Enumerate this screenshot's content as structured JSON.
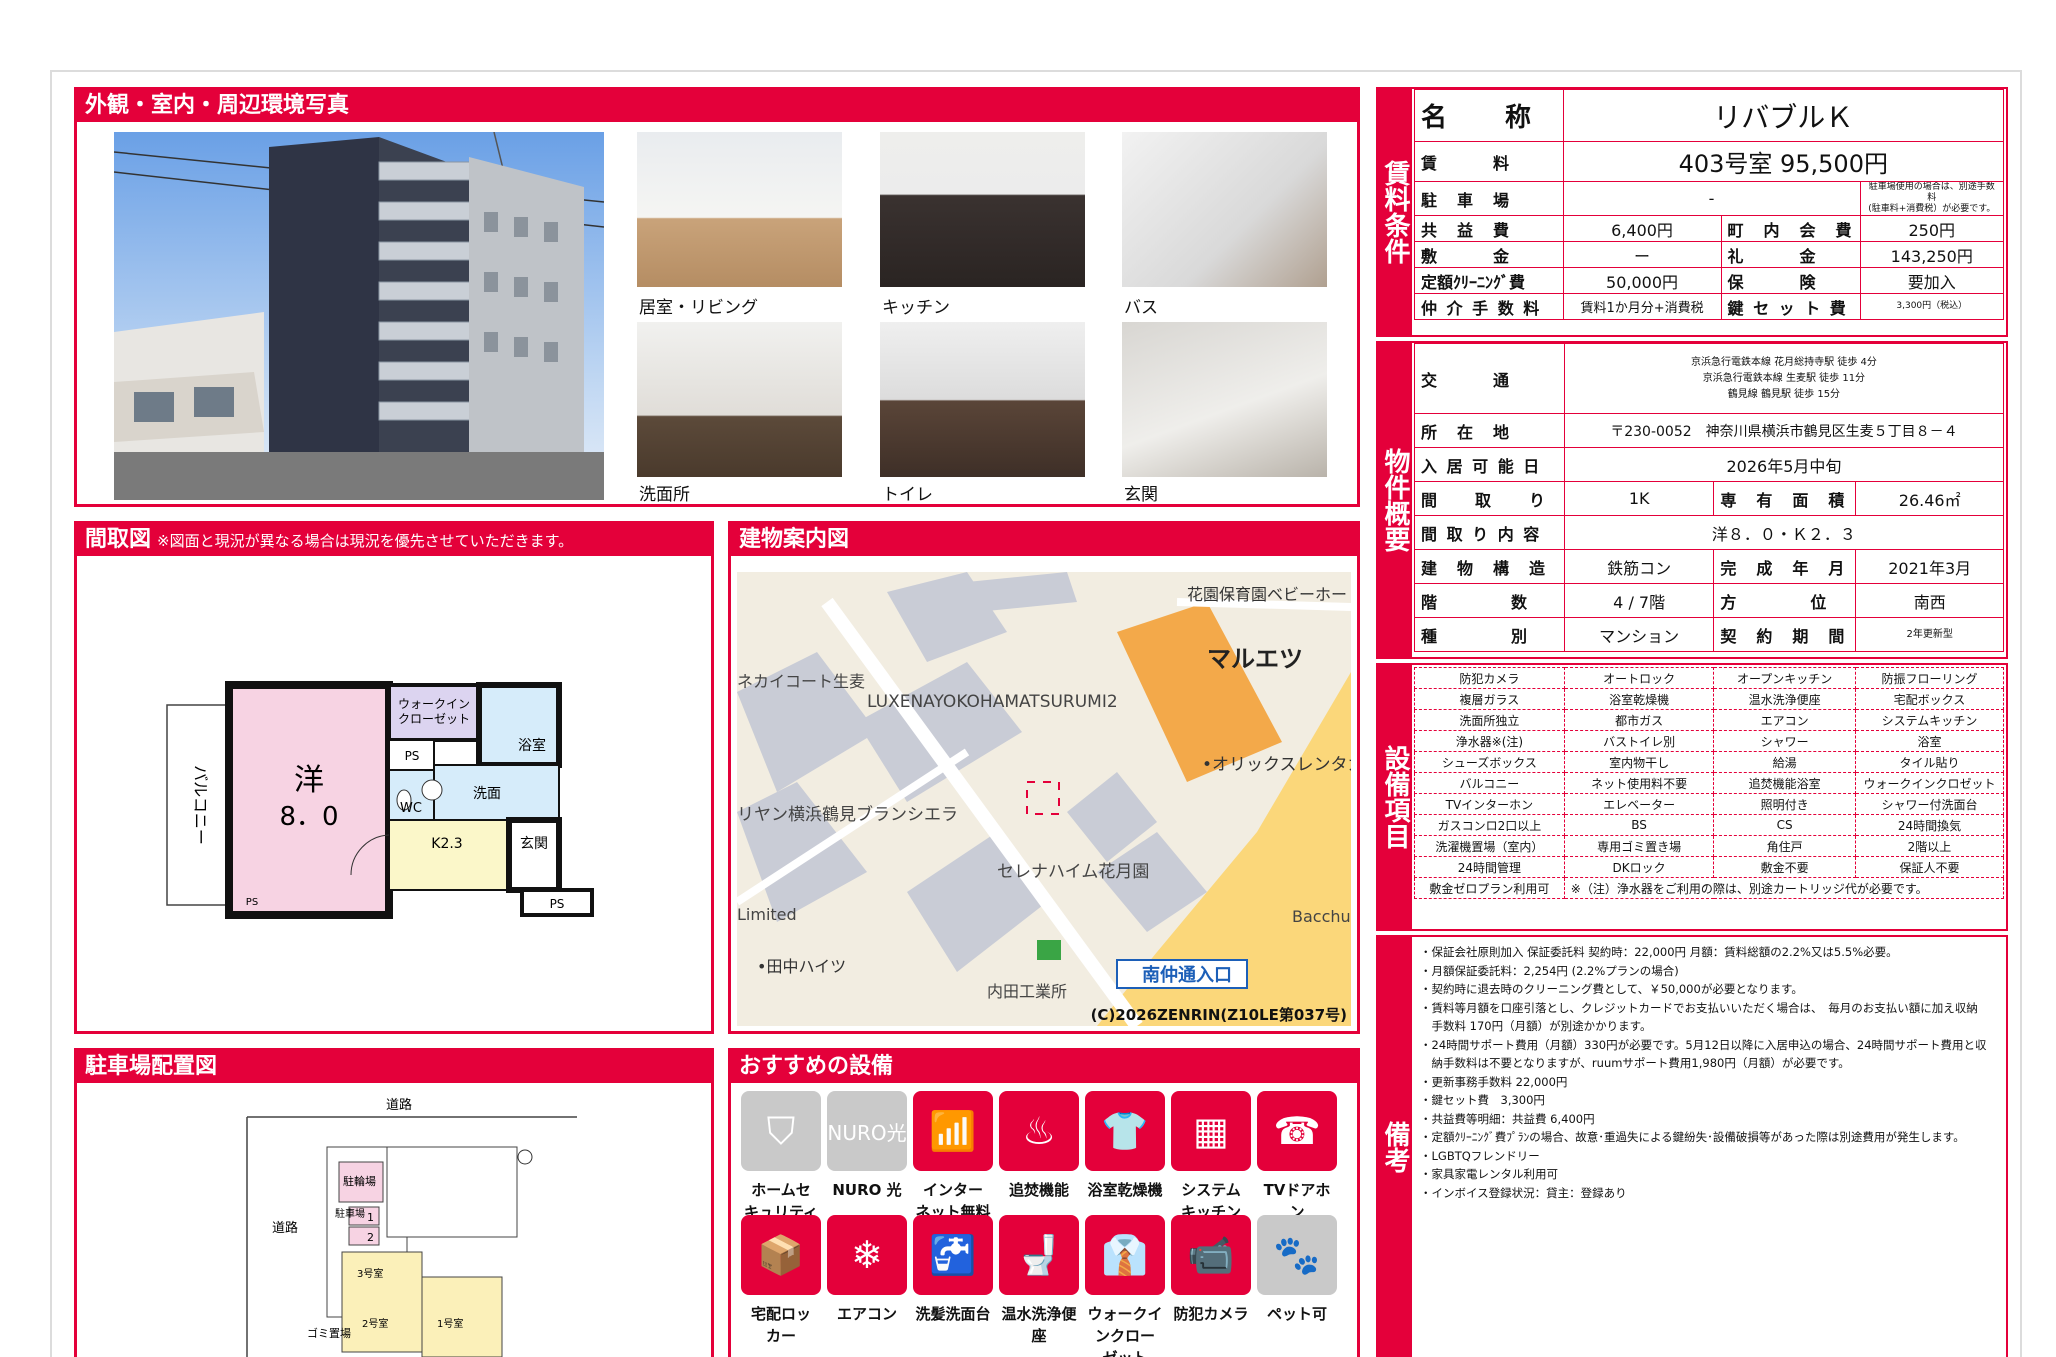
{
  "photos": {
    "title": "外観・室内・周辺環境写真",
    "items": [
      {
        "caption": "居室・リビング"
      },
      {
        "caption": "キッチン"
      },
      {
        "caption": "バス"
      },
      {
        "caption": "洗面所"
      },
      {
        "caption": "トイレ"
      },
      {
        "caption": "玄関"
      }
    ]
  },
  "floorplan": {
    "title": "間取図",
    "note": "※図面と現況が異なる場合は現況を優先させていただきます。",
    "labels": {
      "balcony": "バルコニー",
      "room": "洋",
      "room_size": "8．0",
      "closet": "ウォークイン\nクローゼット",
      "bath": "浴室",
      "ps": "PS",
      "wc": "WC",
      "washroom": "洗面",
      "kitchen": "K2.3",
      "entrance": "玄関",
      "ps2": "PS",
      "ps3": "PS"
    }
  },
  "mapinfo": {
    "title": "建物案内図",
    "labels": {
      "nursery": "花園保育園ベビーホー",
      "supermarket": "マルエツ",
      "cat": "ネカイコート生麦",
      "luxena": "LUXENAYOKOHAMATSURUMI2",
      "orix": "•オリックスレンタカ",
      "sereno": "リヤン横浜鶴見ブランシエラ",
      "serena": "セレナハイム花月園",
      "limited": "Limited",
      "tanaka": "•田中ハイツ",
      "uchida": "内田工業所",
      "minami": "南仲通入口",
      "bacchu": "Bacchu",
      "copyright": "(C)2026ZENRIN(Z10LE第037号)"
    }
  },
  "parking": {
    "title": "駐車場配置図",
    "labels": {
      "road_top": "道路",
      "road_left": "道路",
      "bike": "駐輪場",
      "car": "駐車場",
      "slot1": "1",
      "slot2": "2",
      "room3": "3号室",
      "room2": "2号室",
      "room1": "1号室",
      "garbage": "ゴミ置場"
    }
  },
  "recommended": {
    "title": "おすすめの設備",
    "items": [
      {
        "label": "ホームセ\nキュリティ",
        "icon": "shield-icon",
        "color": "#c9c9c9",
        "glyph": "⛉"
      },
      {
        "label": "NURO 光",
        "icon": "nuro-icon",
        "color": "#c9c9c9",
        "glyph": "NURO光"
      },
      {
        "label": "インター\nネット無料",
        "icon": "wifi-icon",
        "color": "#e4003a",
        "glyph": "📶"
      },
      {
        "label": "追焚機能",
        "icon": "bathtub-icon",
        "color": "#e4003a",
        "glyph": "♨"
      },
      {
        "label": "浴室乾燥機",
        "icon": "bath-dryer-icon",
        "color": "#e4003a",
        "glyph": "👕"
      },
      {
        "label": "システム\nキッチン",
        "icon": "kitchen-icon",
        "color": "#e4003a",
        "glyph": "▦"
      },
      {
        "label": "TVドアホン",
        "icon": "intercom-icon",
        "color": "#e4003a",
        "glyph": "☎"
      },
      {
        "label": "宅配ロッ\nカー",
        "icon": "delivery-locker-icon",
        "color": "#e4003a",
        "glyph": "📦"
      },
      {
        "label": "エアコン",
        "icon": "aircon-icon",
        "color": "#e4003a",
        "glyph": "❄"
      },
      {
        "label": "洗髪洗面台",
        "icon": "washbasin-icon",
        "color": "#e4003a",
        "glyph": "🚰"
      },
      {
        "label": "温水洗浄便\n座",
        "icon": "toilet-icon",
        "color": "#e4003a",
        "glyph": "🚽"
      },
      {
        "label": "ウォークイ\nンクロー\nゼット",
        "icon": "closet-icon",
        "color": "#e4003a",
        "glyph": "👔"
      },
      {
        "label": "防犯カメラ",
        "icon": "camera-icon",
        "color": "#e4003a",
        "glyph": "📹"
      },
      {
        "label": "ペット可",
        "icon": "paw-icon",
        "color": "#c9c9c9",
        "glyph": "🐾"
      }
    ]
  },
  "rent": {
    "side_title": "賃料条件",
    "name_label": "名　　称",
    "name": "リバブルＫ",
    "rent_label": "賃　　　料",
    "rent": "403号室 95,500円",
    "parking_label": "駐　車　場",
    "parking": "-",
    "parking_note": "駐車場使用の場合は、別途手数料\n(駐車料+消費税）が必要です。",
    "common_label": "共　益　費",
    "common": "6,400円",
    "town_label": "町　内　会　費",
    "town": "250円",
    "deposit_label": "敷　　　金",
    "deposit": "ー",
    "key_money_label": "礼　　　金",
    "key_money": "143,250円",
    "cleaning_label": "定額ｸﾘｰﾆﾝｸﾞ費",
    "cleaning": "50,000円",
    "insurance_label": "保　　　険",
    "insurance": "要加入",
    "brokerage_label": "仲 介 手 数 料",
    "brokerage": "賃料1か月分+消費税",
    "keyset_label": "鍵 セ ッ ト 費",
    "keyset": "3,300円（税込）"
  },
  "property": {
    "side_title": "物件概要",
    "transport_label": "交　　　通",
    "transport": [
      "京浜急行電鉄本線 花月総持寺駅 徒歩 4分",
      "京浜急行電鉄本線 生麦駅 徒歩 11分",
      "鶴見線 鶴見駅 徒歩 15分"
    ],
    "address_label": "所　在　地",
    "address": "〒230-0052　神奈川県横浜市鶴見区生麦５丁目８－４",
    "movein_label": "入 居 可 能 日",
    "movein": "2026年5月中旬",
    "layout_label": "間　　取　　り",
    "layout": "1K",
    "area_label": "専　有　面　積",
    "area": "26.46㎡",
    "layout_detail_label": "間 取 り 内 容",
    "layout_detail": "洋８．０・Ｋ２．３",
    "structure_label": "建　物　構　造",
    "structure": "鉄筋コン",
    "built_label": "完　成　年　月",
    "built": "2021年3月",
    "floor_label": "階　　　　数",
    "floor": "4 / 7階",
    "direction_label": "方　　　　位",
    "direction": "南西",
    "type_label": "種　　　　別",
    "type": "マンション",
    "contract_label": "契　約　期　間",
    "contract": "2年更新型"
  },
  "equipment": {
    "side_title": "設備項目",
    "rows": [
      [
        "防犯カメラ",
        "オートロック",
        "オープンキッチン",
        "防振フローリング"
      ],
      [
        "複層ガラス",
        "浴室乾燥機",
        "温水洗浄便座",
        "宅配ボックス"
      ],
      [
        "洗面所独立",
        "都市ガス",
        "エアコン",
        "システムキッチン"
      ],
      [
        "浄水器※(注)",
        "バストイレ別",
        "シャワー",
        "浴室"
      ],
      [
        "シューズボックス",
        "室内物干し",
        "給湯",
        "タイル貼り"
      ],
      [
        "バルコニー",
        "ネット使用料不要",
        "追焚機能浴室",
        "ウォークインクロゼット"
      ],
      [
        "TVインターホン",
        "エレベーター",
        "照明付き",
        "シャワー付洗面台"
      ],
      [
        "ガスコンロ2口以上",
        "BS",
        "CS",
        "24時間換気"
      ],
      [
        "洗濯機置場（室内）",
        "専用ゴミ置き場",
        "角住戸",
        "2階以上"
      ],
      [
        "24時間管理",
        "DKロック",
        "敷金不要",
        "保証人不要"
      ]
    ],
    "last_left": "敷金ゼロプラン利用可",
    "last_note": "※（注）浄水器をご利用の際は、別途カートリッジ代が必要です。"
  },
  "remarks": {
    "side_title": "備考",
    "lines": [
      "・保証会社原則加入 保証委託料 契約時：22,000円 月額：賃料総額の2.2%又は5.5%必要。",
      "・月額保証委託料：2,254円 (2.2%プランの場合)",
      "・契約時に退去時のクリーニング費として、￥50,000が必要となります。",
      "・賃料等月額を口座引落とし、クレジットカードでお支払いいただく場合は、　毎月のお支払い額に加え収納",
      "　手数料 170円（月額）が別途かかります。",
      "・24時間サポート費用（月額）330円が必要です。5月12日以降に入居申込の場合、24時間サポート費用と収",
      "　納手数料は不要となりますが、ruumサポート費用1,980円（月額）が必要です。",
      "・更新事務手数料 22,000円",
      "・鍵セット費　3,300円",
      "・共益費等明細：共益費 6,400円",
      "・定額ｸﾘｰﾆﾝｸﾞ費ﾌﾟﾗﾝの場合、故意･重過失による鍵紛失･設備破損等があった際は別途費用が発生します。",
      "・LGBTQフレンドリー",
      "・家具家電レンタル利用可",
      "・インボイス登録状況：貸主：登録あり"
    ]
  }
}
